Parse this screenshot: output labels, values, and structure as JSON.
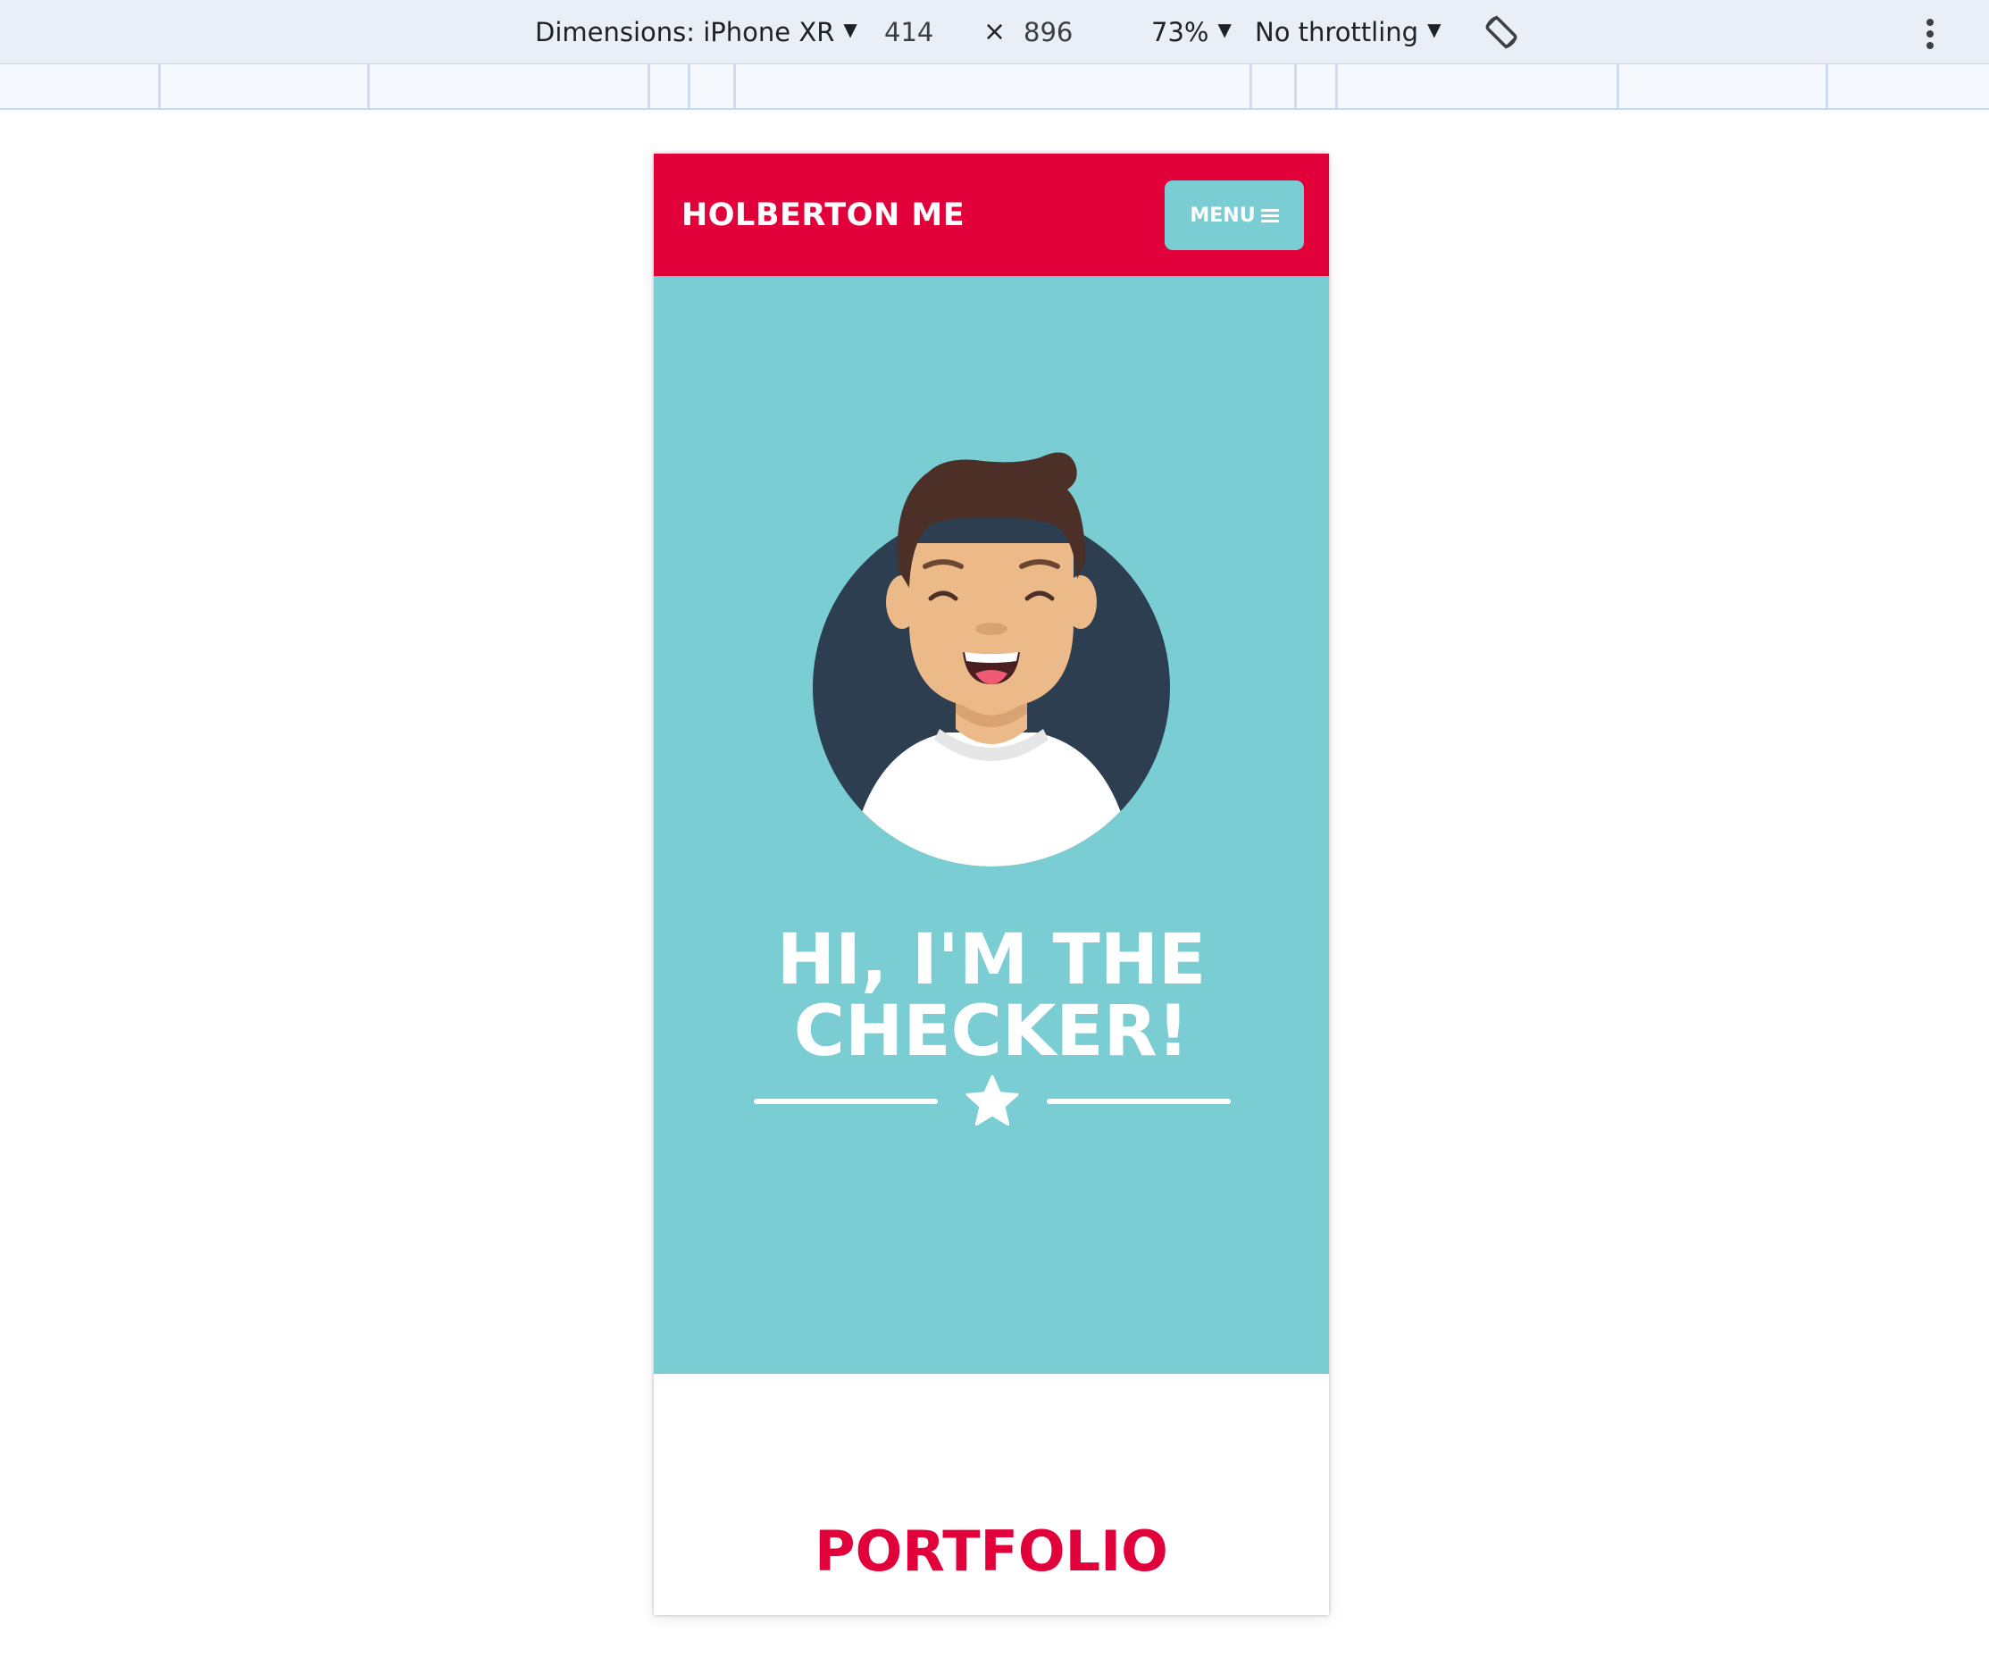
{
  "devtools": {
    "dimensions_label": "Dimensions: iPhone XR",
    "width": "414",
    "times": "×",
    "height": "896",
    "zoom": "73%",
    "throttling": "No throttling",
    "colors": {
      "toolbar_bg": "#eaeff7",
      "ruler_bg": "#f5f8fc"
    }
  },
  "site": {
    "brand": "HOLBERTON ME",
    "menu_label": "MENU",
    "hero_title_line1": "HI, I'M THE",
    "hero_title_line2": "CHECKER!",
    "section_title": "PORTFOLIO",
    "colors": {
      "primary_red": "#e1003a",
      "teal": "#79cdd3",
      "avatar_circle": "#2d3e50",
      "hair": "#4c2f27",
      "skin": "#ecba88",
      "white": "#ffffff"
    },
    "icons": [
      "menu-icon",
      "star-icon",
      "avatar-illustration"
    ]
  }
}
